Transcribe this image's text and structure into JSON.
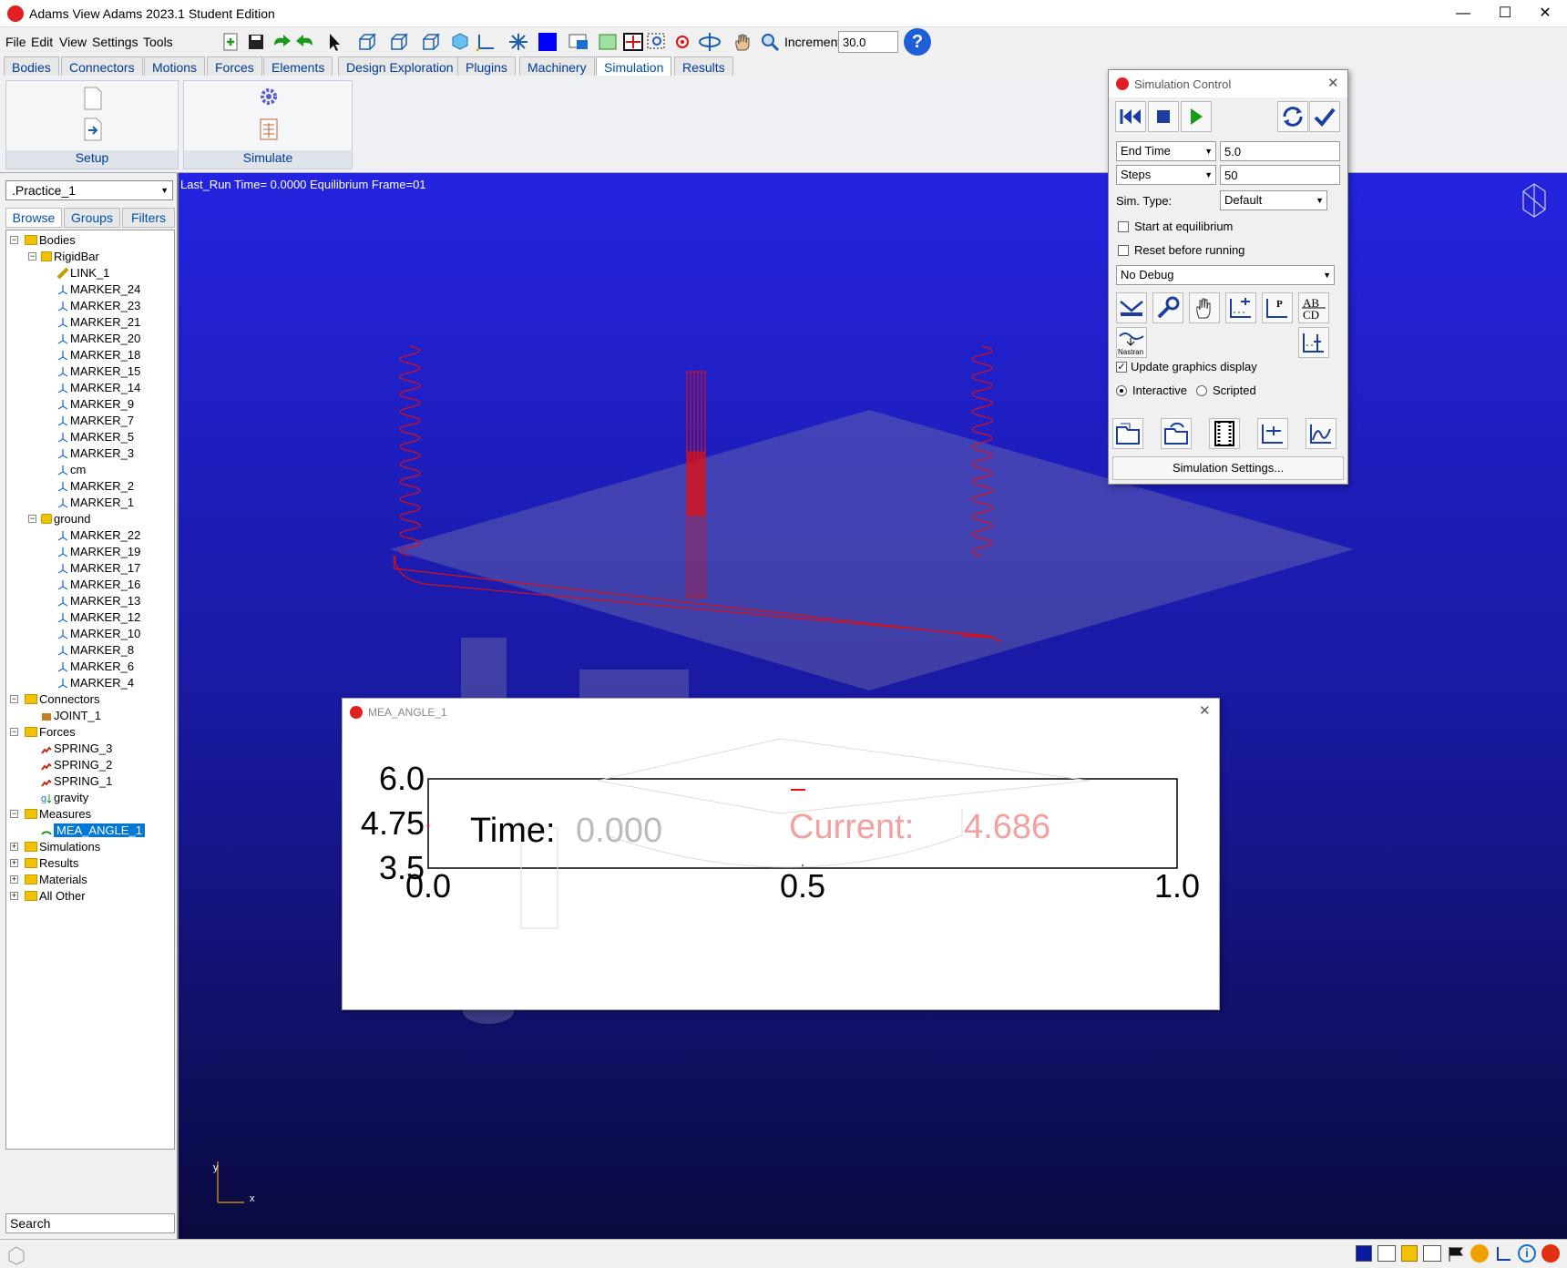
{
  "window": {
    "title": "Adams  View Adams 2023.1 Student Edition",
    "minimize": "—",
    "maximize": "☐",
    "close": "✕"
  },
  "menu": [
    "File",
    "Edit",
    "View",
    "Settings",
    "Tools"
  ],
  "toolbar": {
    "increment_label": "Increment",
    "increment_value": "30.0",
    "help": "?"
  },
  "ribbon_tabs": [
    "Bodies",
    "Connectors",
    "Motions",
    "Forces",
    "Elements",
    "Design Exploration",
    "Plugins",
    "Machinery",
    "Simulation",
    "Results"
  ],
  "active_tab": "Simulation",
  "ribbon_groups": {
    "setup": "Setup",
    "simulate": "Simulate"
  },
  "model": ".Practice_1",
  "browser_tabs": [
    "Browse",
    "Groups",
    "Filters"
  ],
  "tree": [
    {
      "label": "Bodies",
      "level": 0,
      "type": "folder"
    },
    {
      "label": "RigidBar",
      "level": 1,
      "type": "body"
    },
    {
      "label": "LINK_1",
      "level": 2,
      "type": "link"
    },
    {
      "label": "MARKER_24",
      "level": 2,
      "type": "marker"
    },
    {
      "label": "MARKER_23",
      "level": 2,
      "type": "marker"
    },
    {
      "label": "MARKER_21",
      "level": 2,
      "type": "marker"
    },
    {
      "label": "MARKER_20",
      "level": 2,
      "type": "marker"
    },
    {
      "label": "MARKER_18",
      "level": 2,
      "type": "marker"
    },
    {
      "label": "MARKER_15",
      "level": 2,
      "type": "marker"
    },
    {
      "label": "MARKER_14",
      "level": 2,
      "type": "marker"
    },
    {
      "label": "MARKER_9",
      "level": 2,
      "type": "marker"
    },
    {
      "label": "MARKER_7",
      "level": 2,
      "type": "marker"
    },
    {
      "label": "MARKER_5",
      "level": 2,
      "type": "marker"
    },
    {
      "label": "MARKER_3",
      "level": 2,
      "type": "marker"
    },
    {
      "label": "cm",
      "level": 2,
      "type": "marker"
    },
    {
      "label": "MARKER_2",
      "level": 2,
      "type": "marker"
    },
    {
      "label": "MARKER_1",
      "level": 2,
      "type": "marker"
    },
    {
      "label": "ground",
      "level": 1,
      "type": "ground"
    },
    {
      "label": "MARKER_22",
      "level": 2,
      "type": "marker"
    },
    {
      "label": "MARKER_19",
      "level": 2,
      "type": "marker"
    },
    {
      "label": "MARKER_17",
      "level": 2,
      "type": "marker"
    },
    {
      "label": "MARKER_16",
      "level": 2,
      "type": "marker"
    },
    {
      "label": "MARKER_13",
      "level": 2,
      "type": "marker"
    },
    {
      "label": "MARKER_12",
      "level": 2,
      "type": "marker"
    },
    {
      "label": "MARKER_10",
      "level": 2,
      "type": "marker"
    },
    {
      "label": "MARKER_8",
      "level": 2,
      "type": "marker"
    },
    {
      "label": "MARKER_6",
      "level": 2,
      "type": "marker"
    },
    {
      "label": "MARKER_4",
      "level": 2,
      "type": "marker"
    },
    {
      "label": "Connectors",
      "level": 0,
      "type": "folder"
    },
    {
      "label": "JOINT_1",
      "level": 1,
      "type": "joint"
    },
    {
      "label": "Forces",
      "level": 0,
      "type": "folder"
    },
    {
      "label": "SPRING_3",
      "level": 1,
      "type": "spring"
    },
    {
      "label": "SPRING_2",
      "level": 1,
      "type": "spring"
    },
    {
      "label": "SPRING_1",
      "level": 1,
      "type": "spring"
    },
    {
      "label": "gravity",
      "level": 1,
      "type": "gravity"
    },
    {
      "label": "Measures",
      "level": 0,
      "type": "folder"
    },
    {
      "label": "MEA_ANGLE_1",
      "level": 1,
      "type": "measure",
      "selected": true
    },
    {
      "label": "Simulations",
      "level": 0,
      "type": "folder",
      "collapsed": true
    },
    {
      "label": "Results",
      "level": 0,
      "type": "folder",
      "collapsed": true
    },
    {
      "label": "Materials",
      "level": 0,
      "type": "folder",
      "collapsed": true
    },
    {
      "label": "All Other",
      "level": 0,
      "type": "folder",
      "collapsed": true
    }
  ],
  "search_label": "Search",
  "viewport": {
    "run_info": "Last_Run   Time= 0.0000  Equilibrium  Frame=01",
    "axis_y": "y",
    "axis_x": "x"
  },
  "sim_control": {
    "title": "Simulation Control",
    "end_mode": "End Time",
    "end_value": "5.0",
    "steps_mode": "Steps",
    "steps_value": "50",
    "sim_type_label": "Sim. Type:",
    "sim_type": "Default",
    "start_equilibrium": "Start at equilibrium",
    "reset_before": "Reset before running",
    "debug": "No Debug",
    "nastran": "Nastran",
    "update_graphics": "Update graphics display",
    "interactive": "Interactive",
    "scripted": "Scripted",
    "settings_button": "Simulation Settings..."
  },
  "plot": {
    "title": "MEA_ANGLE_1",
    "time_label": "Time:",
    "time_value": "0.000",
    "current_label": "Current:",
    "current_value": "4.686",
    "yticks": [
      "6.0",
      "4.75",
      "3.5"
    ],
    "xticks": [
      "0.0",
      "0.5",
      "1.0"
    ]
  },
  "chart_data": {
    "type": "line",
    "x": [
      0.0
    ],
    "series": [
      {
        "name": "Current",
        "values": [
          4.686
        ]
      }
    ],
    "xlim": [
      0.0,
      1.0
    ],
    "ylim": [
      3.5,
      6.0
    ],
    "xticks": [
      0.0,
      0.5,
      1.0
    ],
    "yticks": [
      3.5,
      4.75,
      6.0
    ],
    "grid": false
  },
  "colors": {
    "viewport_top": "#2424e0",
    "viewport_bottom": "#0a0a40",
    "spring": "#e01010",
    "accent": "#0078d7",
    "current_series": "#e01010"
  }
}
